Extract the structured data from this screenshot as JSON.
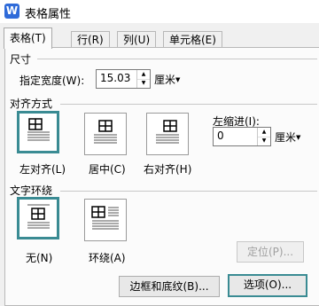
{
  "window": {
    "title": "表格属性",
    "app_icon_letter": "W"
  },
  "tabs": [
    {
      "label": "表格(T)",
      "active": true
    },
    {
      "label": "行(R)",
      "active": false
    },
    {
      "label": "列(U)",
      "active": false
    },
    {
      "label": "单元格(E)",
      "active": false
    }
  ],
  "size": {
    "section_label": "尺寸",
    "width_label": "指定宽度(W):",
    "width_value": "15.03",
    "width_unit": "厘米"
  },
  "alignment": {
    "section_label": "对齐方式",
    "options": [
      {
        "label": "左对齐(L)",
        "selected": true
      },
      {
        "label": "居中(C)",
        "selected": false
      },
      {
        "label": "右对齐(H)",
        "selected": false
      }
    ],
    "indent_label": "左缩进(I):",
    "indent_value": "0",
    "indent_unit": "厘米"
  },
  "wrapping": {
    "section_label": "文字环绕",
    "options": [
      {
        "label": "无(N)",
        "selected": true
      },
      {
        "label": "环绕(A)",
        "selected": false
      }
    ],
    "position_button": "定位(P)..."
  },
  "buttons": {
    "borders_shading": "边框和底纹(B)...",
    "options": "选项(O)..."
  },
  "colors": {
    "accent": "#3a8b93",
    "title_icon": "#2f6bd9"
  }
}
